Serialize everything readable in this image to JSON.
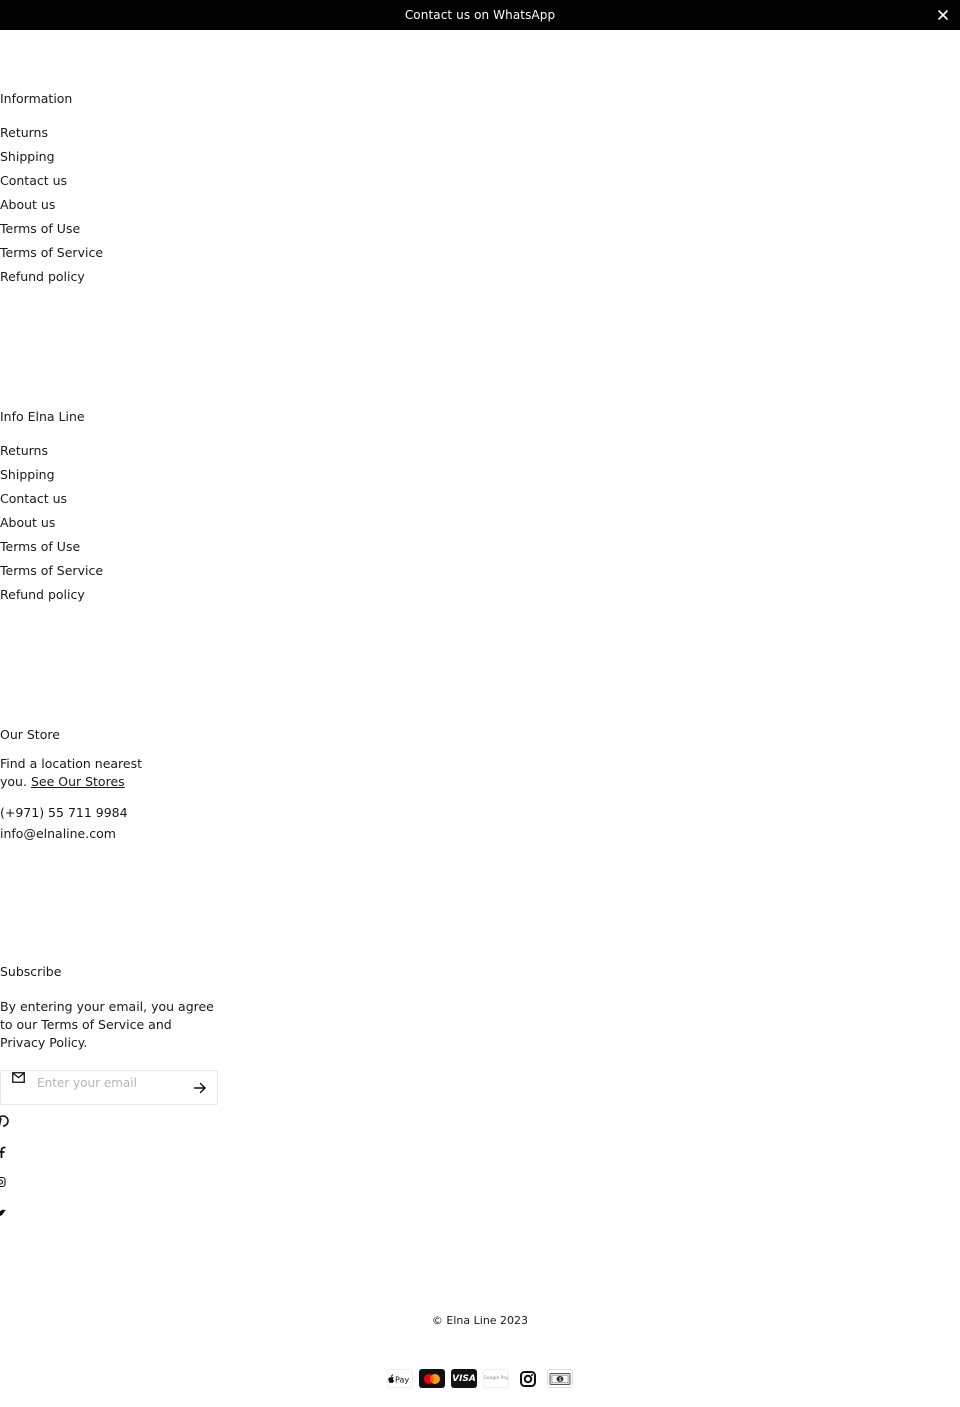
{
  "announcement": {
    "text": "Contact us on WhatsApp",
    "close_icon": "close-icon"
  },
  "information": {
    "title": "Information",
    "links": [
      "Returns",
      "Shipping",
      "Contact us",
      "About us",
      "Terms of Use",
      "Terms of Service",
      "Refund policy"
    ]
  },
  "info_elna": {
    "title": "Info Elna Line",
    "links": [
      "Returns",
      "Shipping",
      "Contact us",
      "About us",
      "Terms of Use",
      "Terms of Service",
      "Refund policy"
    ]
  },
  "store": {
    "title": "Our Store",
    "text": "Find a location nearest you.",
    "link": "See Our Stores",
    "phone": "(+971) 55 711 9984",
    "email": "info@elnaline.com"
  },
  "subscribe": {
    "title": "Subscribe",
    "text": "By entering your email, you agree to our Terms of Service and Privacy Policy.",
    "placeholder": "Enter your email",
    "value": "",
    "mail_icon": "mail-icon",
    "submit_icon": "arrow-right-icon"
  },
  "social": [
    "pinterest-icon",
    "facebook-icon",
    "instagram-icon",
    "twitter-icon"
  ],
  "footer": {
    "copyright": "© Elna Line 2023"
  },
  "payments": [
    {
      "name": "Apple Pay",
      "label": "Pay"
    },
    {
      "name": "Mastercard",
      "label": ""
    },
    {
      "name": "Visa",
      "label": "VISA"
    },
    {
      "name": "Google Pay",
      "label": "Google Pay"
    },
    {
      "name": "Instagram",
      "label": ""
    },
    {
      "name": "Cash",
      "label": ""
    }
  ],
  "colors": {
    "banner_bg": "#000000",
    "text": "#1a1a1a",
    "mastercard_red": "#eb001b",
    "mastercard_orange": "#f79e1b"
  }
}
